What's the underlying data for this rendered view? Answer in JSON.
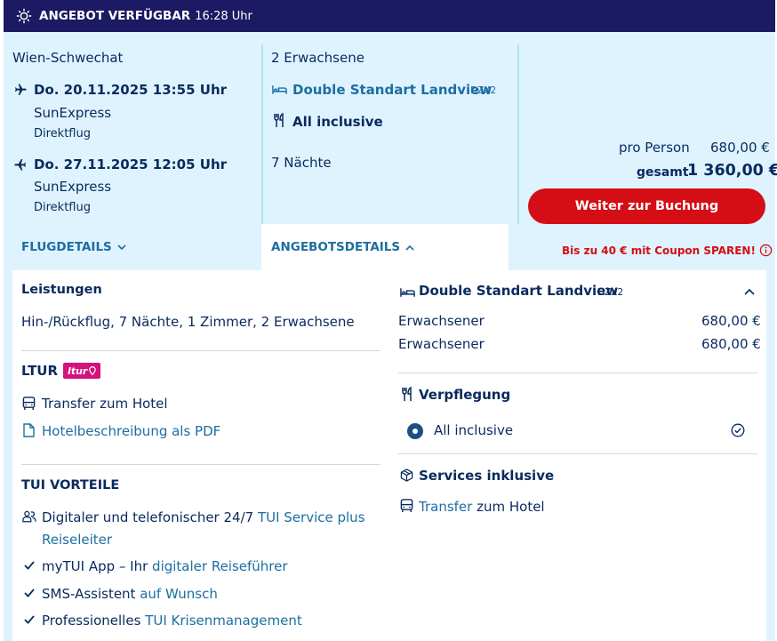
{
  "banner": {
    "title": "ANGEBOT VERFÜGBAR",
    "time": "16:28 Uhr"
  },
  "flight": {
    "departure_airport": "Wien-Schwechat",
    "outbound": {
      "date": "Do. 20.11.2025 13:55 Uhr",
      "airline": "SunExpress",
      "type": "Direktflug"
    },
    "inbound": {
      "date": "Do. 27.11.2025 12:05 Uhr",
      "airline": "SunExpress",
      "type": "Direktflug"
    },
    "details_link": "FLUGDETAILS"
  },
  "offer": {
    "travellers": "2 Erwachsene",
    "room": "Double Standart Landview",
    "room_code": "DZX2",
    "board": "All inclusive",
    "nights": "7 Nächte",
    "details_link": "ANGEBOTSDETAILS"
  },
  "price": {
    "per_person_label": "pro Person",
    "per_person_value": "680,00 €",
    "total_label": "gesamt",
    "total_value": "1 360,00 €",
    "book_button": "Weiter zur Buchung",
    "coupon_text": "Bis zu 40 € mit Coupon SPAREN!"
  },
  "details": {
    "leistungen_title": "Leistungen",
    "leistungen_text": "Hin-/Rückflug, 7 Nächte, 1 Zimmer, 2 Erwachsene",
    "ltur_title": "LTUR",
    "ltur_badge": "ltur",
    "transfer": "Transfer zum Hotel",
    "pdf_link": "Hotelbeschreibung als PDF",
    "vorteile_title": "TUI VORTEILE",
    "v1_text": "Digitaler und telefonischer 24/7",
    "v1_link": "TUI Service plus",
    "v1_link2": "Reiseleiter",
    "v2_text": "myTUI App – Ihr",
    "v2_link": "digitaler Reiseführer",
    "v3_text": "SMS-Assistent",
    "v3_link": "auf Wunsch",
    "v4_text": "Professionelles",
    "v4_link": "TUI Krisenmanagement",
    "room_title": "Double Standart Landview",
    "room_code": "DZX2",
    "adult1_label": "Erwachsener",
    "adult1_price": "680,00 €",
    "adult2_label": "Erwachsener",
    "adult2_price": "680,00 €",
    "verpflegung_title": "Verpflegung",
    "verpflegung_option": "All inclusive",
    "services_title": "Services inklusive",
    "services_link": "Transfer",
    "services_text": "zum Hotel"
  }
}
